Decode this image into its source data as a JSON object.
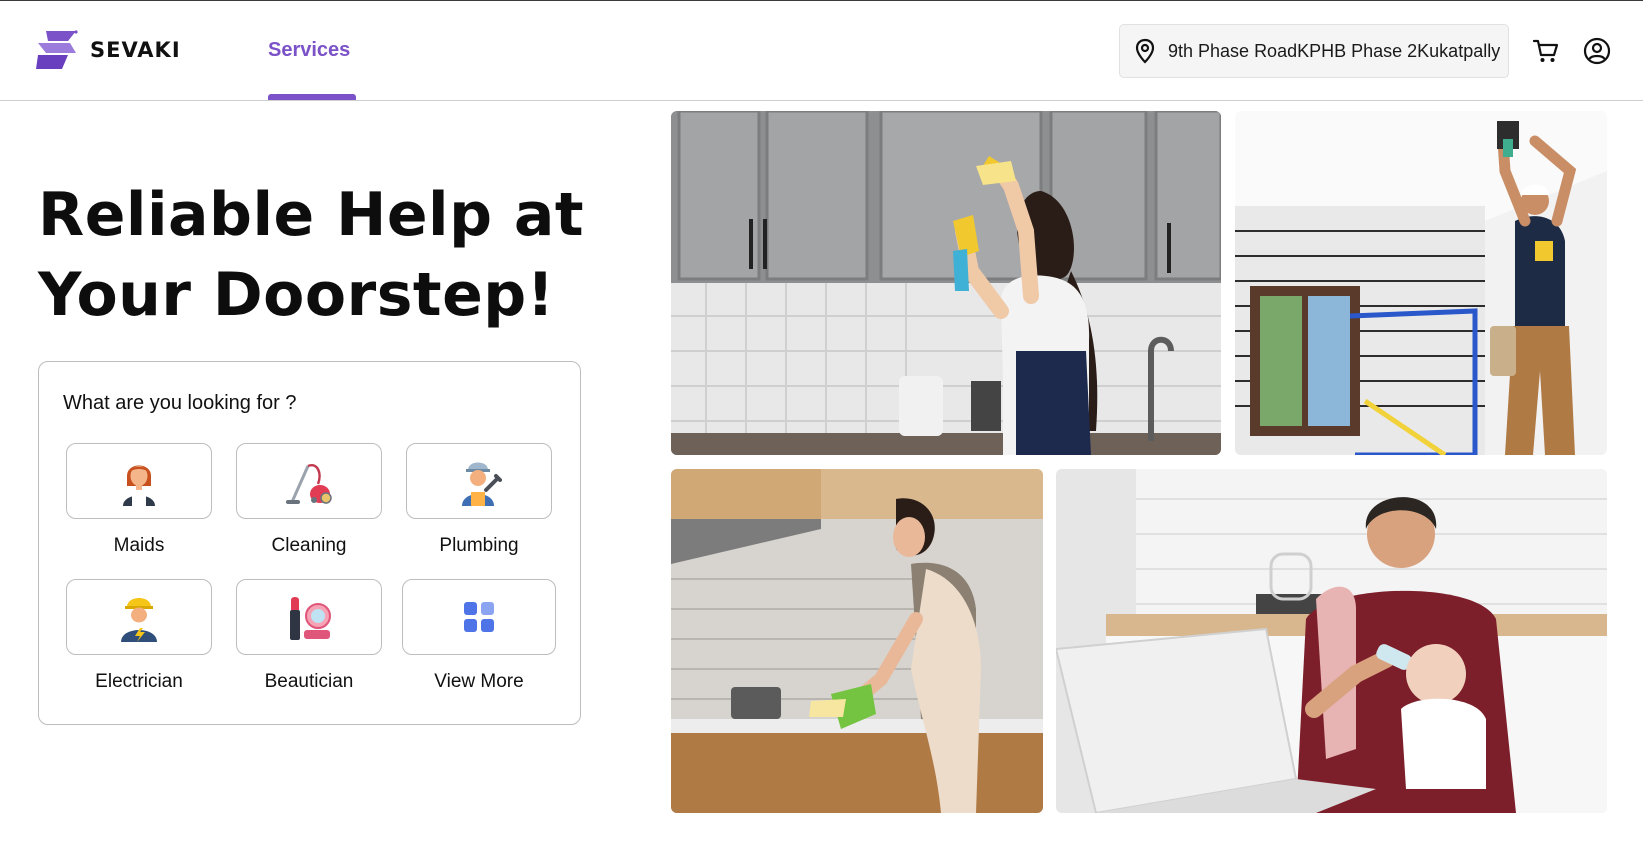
{
  "brand": {
    "name": "SEVAKI",
    "accent": "#7b52c7"
  },
  "nav": {
    "services": "Services"
  },
  "header": {
    "location": "9th Phase RoadKPHB Phase 2Kukatpally",
    "location_icon": "map-pin-icon",
    "cart_icon": "cart-icon",
    "profile_icon": "user-circle-icon"
  },
  "hero": {
    "title_line1": "Reliable Help at",
    "title_line2": "Your Doorstep!"
  },
  "search_card": {
    "title": "What are you looking for ?",
    "services": [
      {
        "label": "Maids",
        "icon": "maid-icon"
      },
      {
        "label": "Cleaning",
        "icon": "vacuum-cleaner-icon"
      },
      {
        "label": "Plumbing",
        "icon": "plumber-icon"
      },
      {
        "label": "Electrician",
        "icon": "electrician-icon"
      },
      {
        "label": "Beautician",
        "icon": "makeup-icon"
      },
      {
        "label": "View More",
        "icon": "grid-icon"
      }
    ]
  }
}
